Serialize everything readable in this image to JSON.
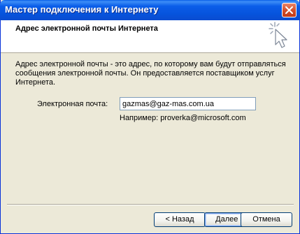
{
  "window": {
    "title": "Мастер подключения к Интернету"
  },
  "header": {
    "title": "Адрес электронной почты Интернета",
    "icon": "wizard-cursor-icon"
  },
  "main": {
    "description": "Адрес электронной почты - это адрес, по которому вам будут отправляться сообщения электронной почты. Он предоставляется поставщиком услуг Интернета.",
    "email_label": "Электронная почта:",
    "email_value": "gazmas@gaz-mas.com.ua",
    "example": "Например: proverka@microsoft.com"
  },
  "buttons": {
    "back": "< Назад",
    "next": "Далее >",
    "cancel": "Отмена"
  },
  "colors": {
    "titlebar": "#0653dc",
    "dialog_bg": "#ece9d8",
    "close": "#d4502c"
  }
}
